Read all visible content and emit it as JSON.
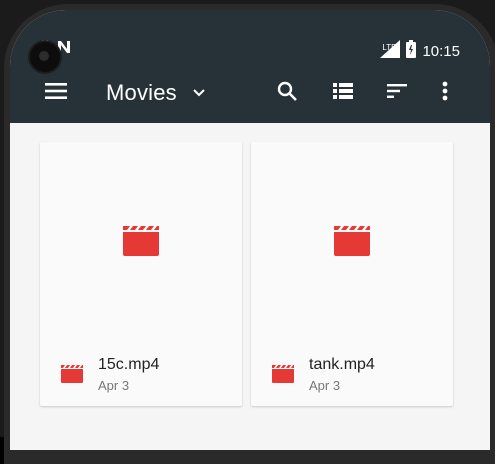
{
  "status_bar": {
    "time": "10:15",
    "network": "LTE",
    "notification_icons": [
      "sim-icon",
      "n-icon"
    ]
  },
  "toolbar": {
    "title": "Movies",
    "icons": [
      "menu-icon",
      "chevron-down-icon",
      "search-icon",
      "list-view-icon",
      "sort-icon",
      "more-vert-icon"
    ]
  },
  "files": [
    {
      "name": "15c.mp4",
      "date": "Apr 3"
    },
    {
      "name": "tank.mp4",
      "date": "Apr 3"
    }
  ],
  "colors": {
    "toolbar_bg": "#263238",
    "video_icon": "#e53935",
    "content_bg": "#f5f5f5"
  }
}
